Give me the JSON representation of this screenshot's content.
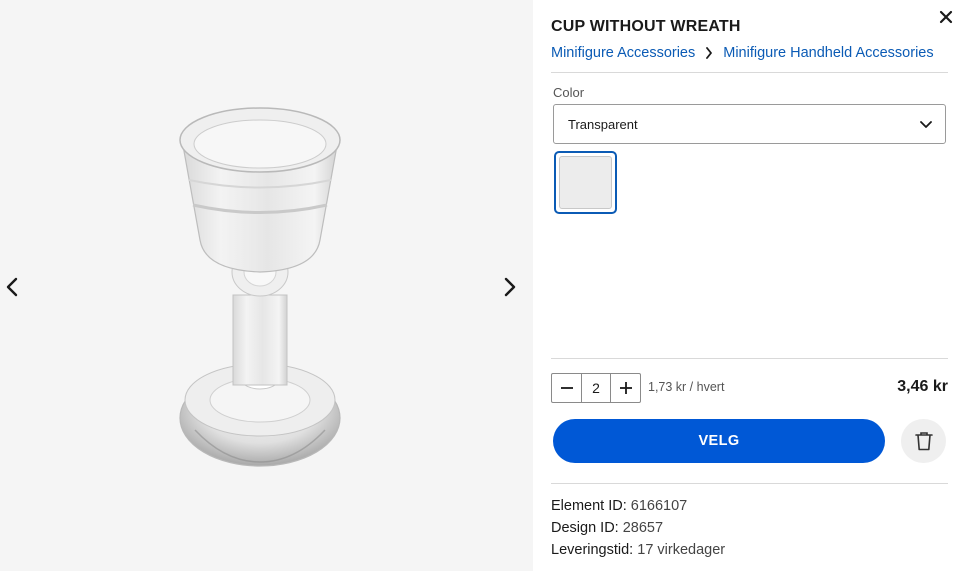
{
  "viewer": {
    "prev_icon": "chevron-left-icon",
    "next_icon": "chevron-right-icon",
    "image_subject": "transparent-goblet"
  },
  "product": {
    "title": "CUP WITHOUT WREATH",
    "close_icon": "close-icon",
    "breadcrumb": [
      "Minifigure Accessories",
      "Minifigure Handheld Accessories"
    ]
  },
  "color": {
    "label": "Color",
    "selected": "Transparent",
    "swatch_color": "#ececec"
  },
  "purchase": {
    "quantity": "2",
    "unit_price": "1,73 kr / hvert",
    "total_price": "3,46 kr",
    "cta_label": "VELG",
    "accent_color": "#0058d6"
  },
  "details": {
    "element_id_label": "Element ID:",
    "element_id": "6166107",
    "design_id_label": "Design ID:",
    "design_id": "28657",
    "delivery_label": "Leveringstid:",
    "delivery": "17 virkedager"
  }
}
